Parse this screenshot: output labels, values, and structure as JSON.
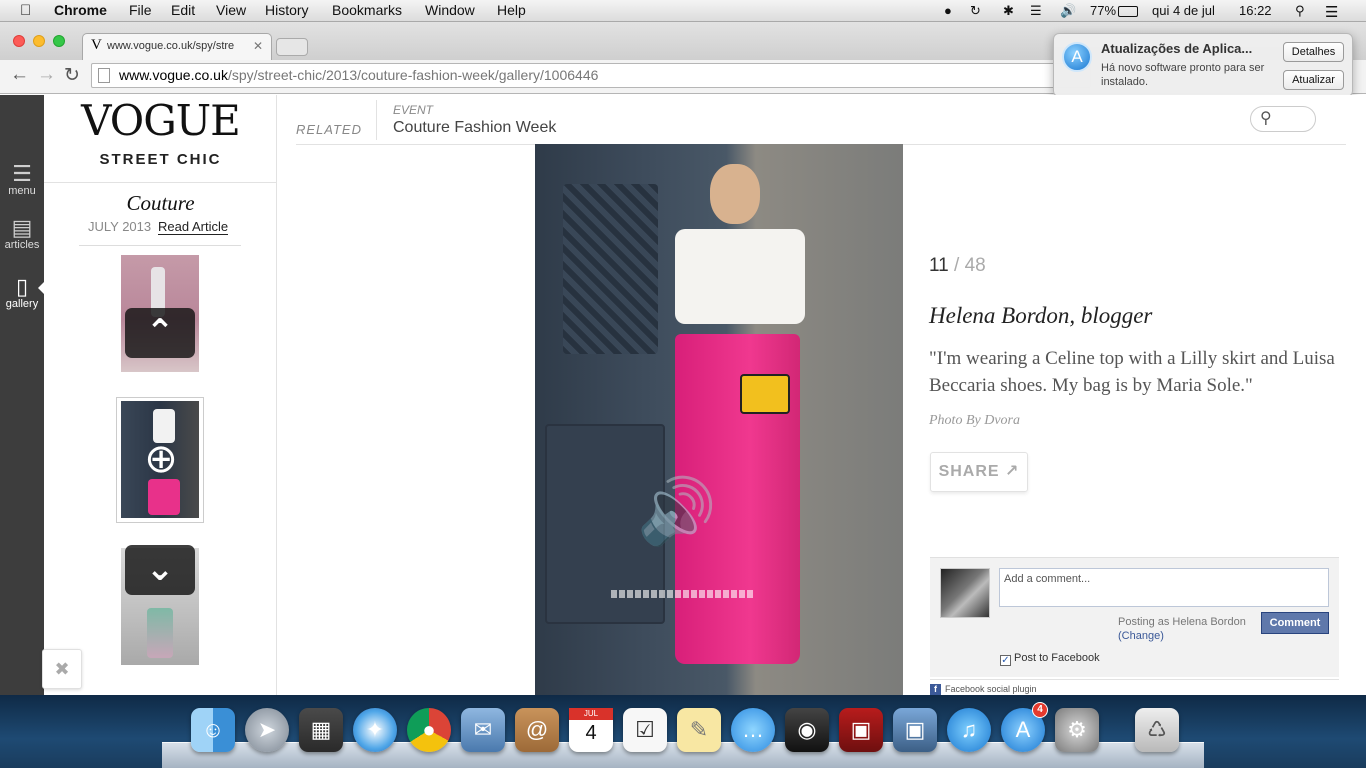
{
  "menubar": {
    "app_name": "Chrome",
    "items": [
      "File",
      "Edit",
      "View",
      "History",
      "Bookmarks",
      "Window",
      "Help"
    ],
    "battery": "77%",
    "date": "qui 4 de jul",
    "time": "16:22"
  },
  "browser": {
    "tab_title": "www.vogue.co.uk/spy/stre",
    "url_domain": "www.vogue.co.uk",
    "url_path": "/spy/street-chic/2013/couture-fashion-week/gallery/1006446"
  },
  "notification": {
    "title": "Atualizações de Aplica...",
    "message": "Há novo software pronto para ser instalado.",
    "details_button": "Detalhes",
    "update_button": "Atualizar"
  },
  "left_nav": {
    "menu_label": "menu",
    "articles_label": "articles",
    "gallery_label": "gallery"
  },
  "side_panel": {
    "logo": "VOGUE",
    "section": "STREET CHIC",
    "article_title": "Couture",
    "date": "JULY 2013",
    "read_article": "Read Article"
  },
  "top_meta": {
    "related_label": "RELATED",
    "event_label": "EVENT",
    "event_name": "Couture Fashion Week"
  },
  "gallery": {
    "current": "11",
    "separator": "/",
    "total": "48",
    "person": "Helena Bordon, blogger",
    "quote": "\"I'm wearing a Celine top with a Lilly skirt and Luisa Beccaria shoes. My bag is by Maria Sole.\"",
    "credit": "Photo By Dvora",
    "share_label": "SHARE"
  },
  "facebook": {
    "comment_placeholder": "Add a comment...",
    "posting_as": "Posting as Helena Bordon",
    "change": "(Change)",
    "comment_button": "Comment",
    "post_to_facebook": "Post to Facebook",
    "plugin_label": "Facebook social plugin"
  },
  "dock": {
    "app_store_badge": "4",
    "calendar_month": "JUL",
    "calendar_day": "4"
  },
  "colors": {
    "accent_pink": "#e8318a",
    "facebook_blue": "#5f78ab",
    "nav_dark": "#3d3d3d"
  }
}
